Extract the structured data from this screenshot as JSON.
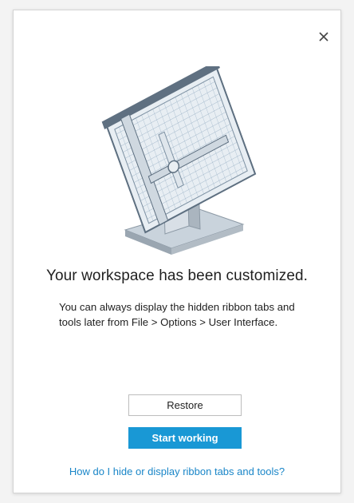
{
  "dialog": {
    "close_icon": "close-icon",
    "illustration_icon": "drafting-table-icon",
    "heading": "Your workspace has been customized.",
    "body": "You can always display the hidden ribbon tabs and tools later from File > Options > User Interface.",
    "restore_label": "Restore",
    "start_label": "Start working",
    "help_link": "How do I hide or display ribbon tabs and tools?"
  },
  "colors": {
    "primary_button": "#1998d5",
    "link": "#1a86c8",
    "text": "#1f1f1f"
  }
}
